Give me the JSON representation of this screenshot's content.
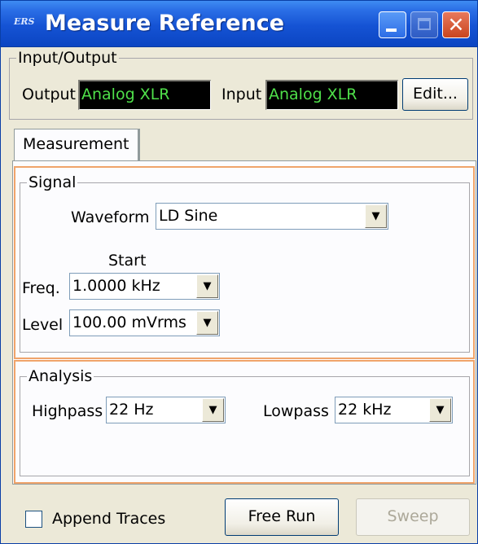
{
  "window": {
    "title": "Measure Reference",
    "app_icon_text": "ERS"
  },
  "io_group": {
    "legend": "Input/Output",
    "output_label": "Output",
    "output_value": "Analog XLR",
    "input_label": "Input",
    "input_value": "Analog XLR",
    "edit_button": "Edit..."
  },
  "tabs": [
    {
      "label": "Measurement"
    }
  ],
  "signal": {
    "legend": "Signal",
    "waveform_label": "Waveform",
    "waveform_value": "LD Sine",
    "start_label": "Start",
    "freq_label": "Freq.",
    "freq_value": "1.0000 kHz",
    "level_label": "Level",
    "level_value": "100.00 mVrms"
  },
  "analysis": {
    "legend": "Analysis",
    "highpass_label": "Highpass",
    "highpass_value": "22 Hz",
    "lowpass_label": "Lowpass",
    "lowpass_value": "22 kHz"
  },
  "footer": {
    "append_traces_label": "Append Traces",
    "append_traces_checked": false,
    "free_run_button": "Free Run",
    "sweep_button": "Sweep"
  },
  "colors": {
    "accent_orange": "#f0a46a",
    "readout_green": "#4fe04a",
    "titlebar_blue": "#1553d4"
  }
}
